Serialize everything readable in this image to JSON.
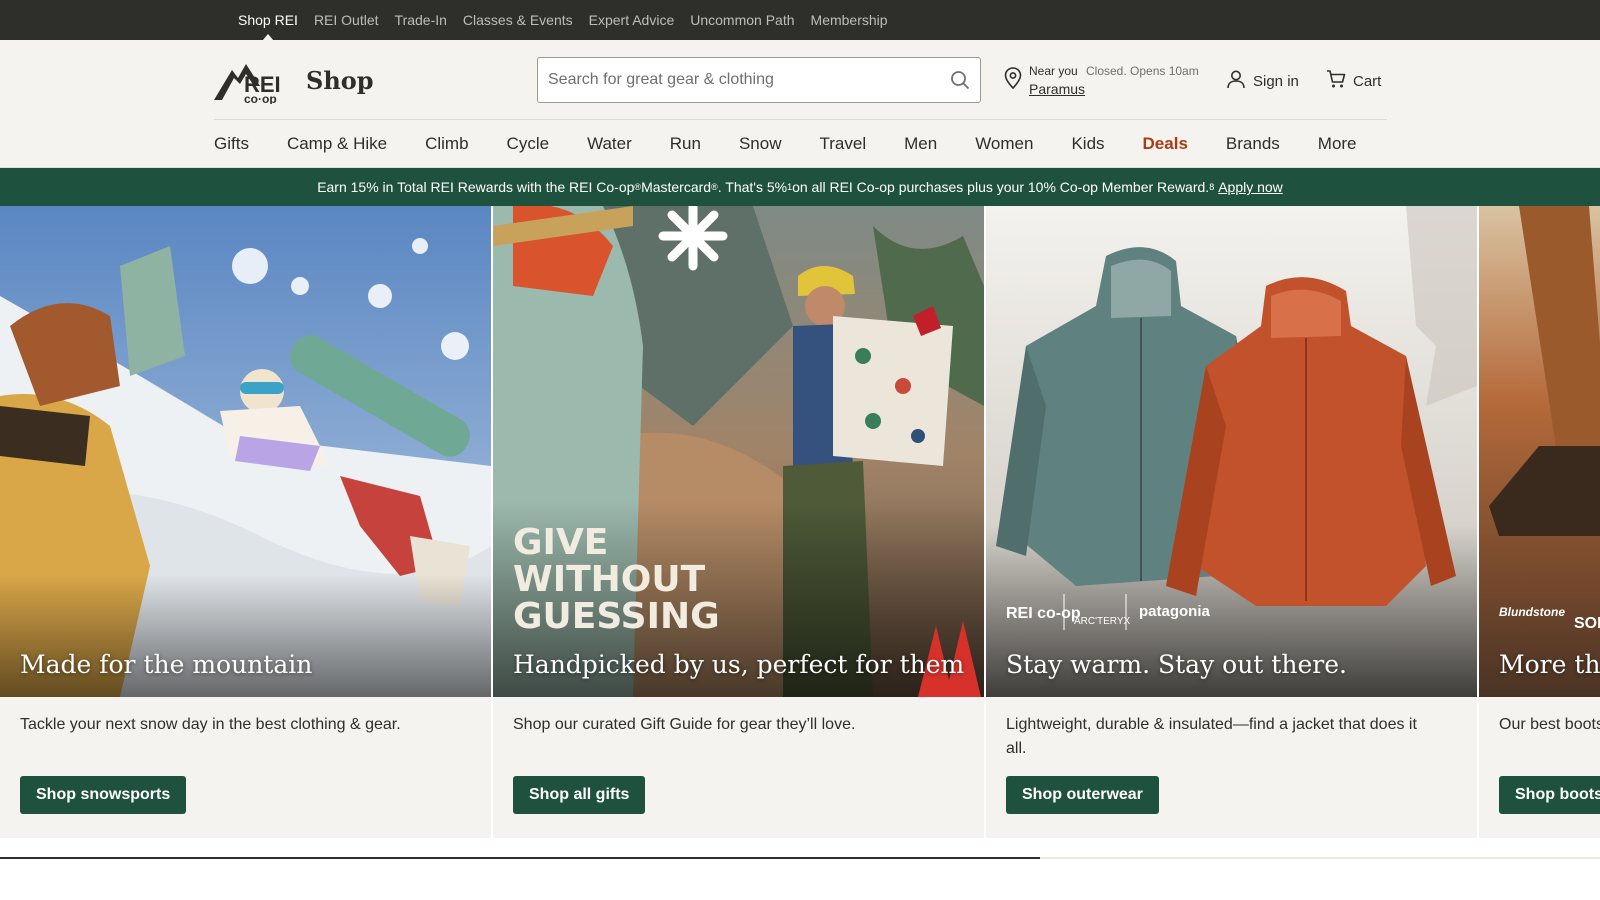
{
  "utility_nav": {
    "items": [
      "Shop REI",
      "REI Outlet",
      "Trade-In",
      "Classes & Events",
      "Expert Advice",
      "Uncommon Path",
      "Membership"
    ],
    "active": "Shop REI"
  },
  "header": {
    "logo_text": "REI co-op",
    "section_title": "Shop",
    "search_placeholder": "Search for great gear & clothing",
    "store": {
      "near_label": "Near you",
      "hours": "Closed. Opens 10am",
      "city": "Paramus"
    },
    "signin_label": "Sign in",
    "cart_label": "Cart"
  },
  "main_nav": {
    "items": [
      "Gifts",
      "Camp & Hike",
      "Climb",
      "Cycle",
      "Water",
      "Run",
      "Snow",
      "Travel",
      "Men",
      "Women",
      "Kids",
      "Deals",
      "Brands",
      "More"
    ],
    "highlight": "Deals",
    "highlight_color": "#a63d17"
  },
  "promo": {
    "text_1": "Earn 15% in Total REI Rewards with the REI Co-op",
    "sup_1": "®",
    "text_2": " Mastercard",
    "sup_2": "®",
    "text_3": ". That's 5%",
    "sup_3": "1",
    "text_4": " on all REI Co-op purchases plus your 10% Co-op Member Reward.",
    "sup_4": "8",
    "link": "Apply now",
    "bg_color": "#1f513f"
  },
  "cards": [
    {
      "title": "Made for the mountain",
      "description": "Tackle your next snow day in the best clothing & gear.",
      "button": "Shop snowsports"
    },
    {
      "title": "Handpicked by us, perfect for them",
      "description": "Shop our curated Gift Guide for gear they’ll love.",
      "button": "Shop all gifts",
      "overlay_text": [
        "GIVE",
        "WITHOUT",
        "GUESSING"
      ]
    },
    {
      "title": "Stay warm. Stay out there.",
      "description": "Lightweight, durable & insulated—find a jacket that does it all.",
      "button": "Shop outerwear",
      "brands": [
        "REI co-op",
        "ARC'TERYX",
        "patagonia"
      ]
    },
    {
      "title": "More than",
      "description": "Our best boots",
      "button": "Shop boots",
      "brands": [
        "Blundstone",
        "SOREL"
      ]
    }
  ],
  "carousel_progress": 0.65,
  "colors": {
    "brand_green": "#1f513f",
    "dark": "#2e2e2b",
    "cream": "#f5f3ef"
  }
}
